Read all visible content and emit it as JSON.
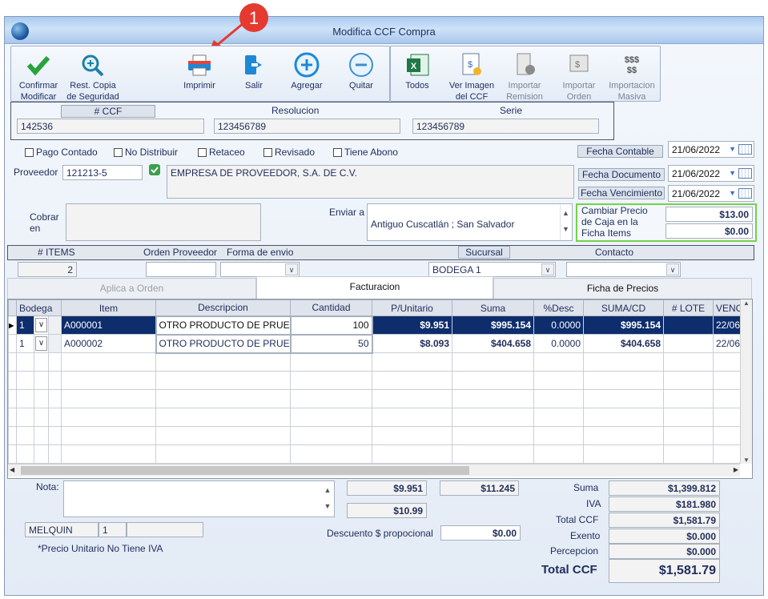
{
  "window": {
    "title": "Modifica CCF Compra"
  },
  "annotation": {
    "number": "1"
  },
  "toolbar": {
    "confirm": "Confirmar\nModificar",
    "restore": "Rest. Copia\nde Seguridad",
    "print": "Imprimir",
    "exit": "Salir",
    "add": "Agregar",
    "remove": "Quitar",
    "all": "Todos",
    "view_image": "Ver Imagen\ndel CCF",
    "import_remission": "Importar\nRemision",
    "import_order": "Importar\nOrden",
    "mass_import": "Importacion\nMasiva"
  },
  "header": {
    "ccf_label": "# CCF",
    "ccf": "142536",
    "resolucion_label": "Resolucion",
    "resolucion": "123456789",
    "serie_label": "Serie",
    "serie": "123456789"
  },
  "checks": {
    "pago_contado": "Pago Contado",
    "no_distribuir": "No Distribuir",
    "retaceo": "Retaceo",
    "revisado": "Revisado",
    "tiene_abono": "Tiene Abono"
  },
  "dates": {
    "contable_label": "Fecha Contable",
    "contable": "21/06/2022",
    "documento_label": "Fecha Documento",
    "documento": "21/06/2022",
    "vencimiento_label": "Fecha Vencimiento",
    "vencimiento": "21/06/2022"
  },
  "proveedor": {
    "label": "Proveedor",
    "code": "121213-5",
    "name": "EMPRESA DE PROVEEDOR, S.A. DE C.V."
  },
  "cobrar_label": "Cobrar\nen",
  "enviar": {
    "label": "Enviar a",
    "value": "Antiguo Cuscatlán ; San Salvador"
  },
  "precio_caja": {
    "label": "Cambiar Precio\nde Caja en la\nFicha Items",
    "value1": "$13.00",
    "value2": "$0.00"
  },
  "info": {
    "items_label": "# ITEMS",
    "items": "2",
    "orden_label": "Orden Proveedor",
    "envio_label": "Forma de envio",
    "sucursal_label": "Sucursal",
    "sucursal": "BODEGA 1",
    "contacto_label": "Contacto"
  },
  "tabs": [
    "Aplica a Orden",
    "Facturacion",
    "Ficha de Precios"
  ],
  "grid": {
    "headers": [
      "Bodega",
      "Item",
      "Descripcion",
      "Cantidad",
      "P/Unitario",
      "Suma",
      "%Desc",
      "SUMA/CD",
      "# LOTE",
      "VENC"
    ],
    "rows": [
      {
        "bodega": "1",
        "item": "A000001",
        "desc": "OTRO PRODUCTO DE PRUE",
        "cantidad": "100",
        "punit": "$9.951",
        "suma": "$995.154",
        "desc_pct": "0.0000",
        "sumacd": "$995.154",
        "lote": "",
        "venc": "22/06"
      },
      {
        "bodega": "1",
        "item": "A000002",
        "desc": "OTRO PRODUCTO DE PRUE",
        "cantidad": "50",
        "punit": "$8.093",
        "suma": "$404.658",
        "desc_pct": "0.0000",
        "sumacd": "$404.658",
        "lote": "",
        "venc": "22/06"
      }
    ]
  },
  "footer": {
    "nota_label": "Nota:",
    "user": "MELQUIN",
    "user_num": "1",
    "note_iva": "*Precio Unitario No Tiene IVA",
    "p1": "$9.951",
    "p2": "$11.245",
    "p3": "$10.99",
    "descuento_label": "Descuento $ propocional",
    "descuento": "$0.00",
    "suma_label": "Suma",
    "suma": "$1,399.812",
    "iva_label": "IVA",
    "iva": "$181.980",
    "total_ccf_label": "Total CCF",
    "total_ccf": "$1,581.79",
    "exento_label": "Exento",
    "exento": "$0.000",
    "percepcion_label": "Percepcion",
    "percepcion": "$0.000",
    "grand_total_label": "Total CCF",
    "grand_total": "$1,581.79"
  }
}
